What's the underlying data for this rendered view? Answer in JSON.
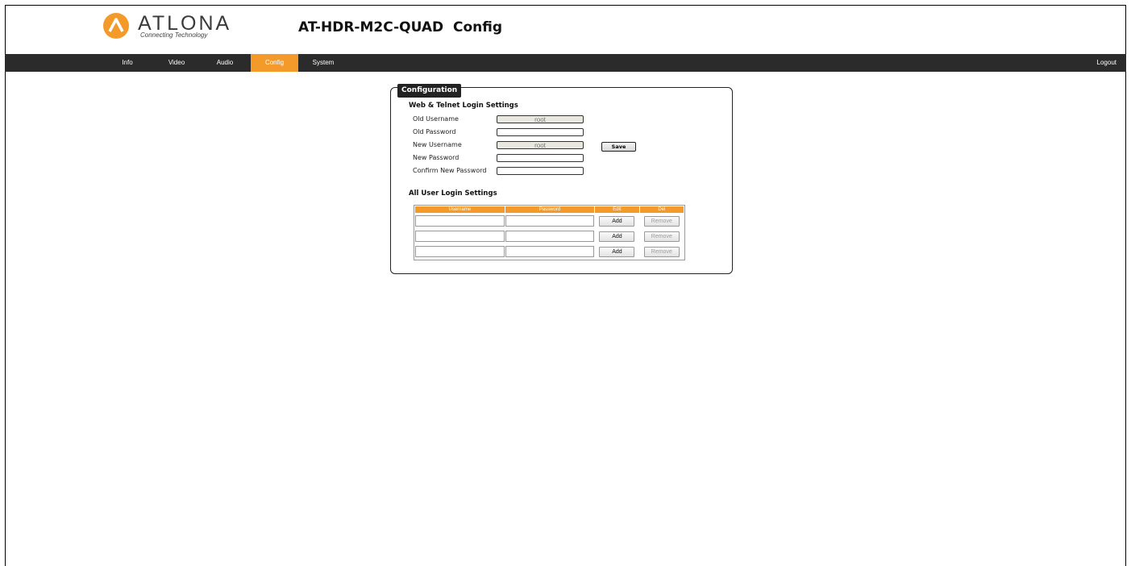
{
  "header": {
    "brand": "ATLONA",
    "tagline": "Connecting Technology",
    "title": "AT-HDR-M2C-QUAD  Config",
    "logo_color": "#f39a2a"
  },
  "nav": {
    "items": [
      {
        "label": "Info",
        "active": false
      },
      {
        "label": "Video",
        "active": false
      },
      {
        "label": "Audio",
        "active": false
      },
      {
        "label": "Config",
        "active": true
      },
      {
        "label": "System",
        "active": false
      }
    ],
    "logout_label": "Logout",
    "bar_color": "#2b2b2b",
    "active_color": "#f39a2a"
  },
  "config": {
    "panel_title": "Configuration",
    "login_section_title": "Web & Telnet Login Settings",
    "fields": {
      "old_username": {
        "label": "Old Username",
        "value": "root"
      },
      "old_password": {
        "label": "Old Password",
        "value": ""
      },
      "new_username": {
        "label": "New Username",
        "value": "root"
      },
      "new_password": {
        "label": "New Password",
        "value": ""
      },
      "confirm_password": {
        "label": "Confirm New Password",
        "value": ""
      }
    },
    "save_label": "Save",
    "users_section_title": "All User Login Settings",
    "table": {
      "columns": [
        "Username",
        "Password",
        "Edit",
        "Del"
      ],
      "rows": [
        {
          "username": "",
          "password": "",
          "edit_label": "Add",
          "del_label": "Remove"
        },
        {
          "username": "",
          "password": "",
          "edit_label": "Add",
          "del_label": "Remove"
        },
        {
          "username": "",
          "password": "",
          "edit_label": "Add",
          "del_label": "Remove"
        }
      ]
    }
  }
}
